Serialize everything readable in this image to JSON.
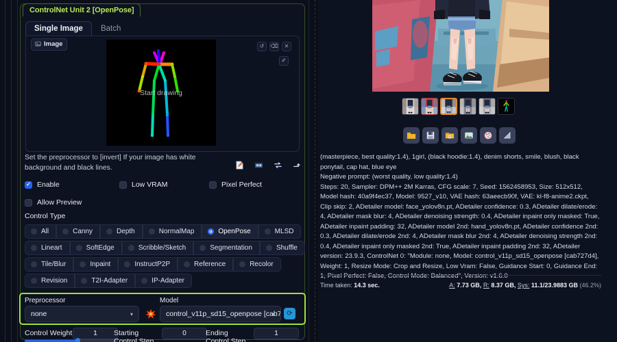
{
  "panel": {
    "accordion_title": "ControlNet Unit 2 [OpenPose]",
    "tabs": [
      {
        "label": "Single Image",
        "active": true
      },
      {
        "label": "Batch",
        "active": false
      }
    ],
    "image_chip_label": "Image",
    "canvas_hint": "Start drawing",
    "canvas_tools": [
      {
        "name": "undo-icon",
        "glyph": "↺"
      },
      {
        "name": "erase-icon",
        "glyph": "⌫"
      },
      {
        "name": "close-icon",
        "glyph": "✕"
      },
      {
        "name": "draw-icon",
        "glyph": "✎"
      }
    ],
    "hint_text": "Set the preprocessor to [invert] If your image has white background and black lines.",
    "mini_icons": [
      "open-new-canvas-icon",
      "send-to-img2img-icon",
      "swap-icon",
      "send-dimensions-icon"
    ],
    "checkboxes": [
      {
        "label": "Enable",
        "checked": true
      },
      {
        "label": "Low VRAM",
        "checked": false
      },
      {
        "label": "Pixel Perfect",
        "checked": false
      },
      {
        "label": "Allow Preview",
        "checked": false
      }
    ],
    "control_type_label": "Control Type",
    "control_types": [
      [
        "All",
        "Canny",
        "Depth",
        "NormalMap",
        "OpenPose",
        "MLSD"
      ],
      [
        "Lineart",
        "SoftEdge",
        "Scribble/Sketch",
        "Segmentation",
        "Shuffle"
      ],
      [
        "Tile/Blur",
        "Inpaint",
        "InstructP2P",
        "Reference",
        "Recolor"
      ],
      [
        "Revision",
        "T2I-Adapter",
        "IP-Adapter"
      ]
    ],
    "control_type_selected": "OpenPose",
    "preprocessor_label": "Preprocessor",
    "preprocessor_value": "none",
    "model_label": "Model",
    "model_value": "control_v11p_sd15_openpose [cab7",
    "refresh_icon": "refresh-icon",
    "star_icon": "explosion-icon",
    "sliders": [
      {
        "label": "Control Weight",
        "value": "1"
      },
      {
        "label": "Starting Control Step",
        "value": "0"
      },
      {
        "label": "Ending Control Step",
        "value": "1"
      }
    ],
    "highlight_color": "#9ee331",
    "accent_color": "#2563eb"
  },
  "output": {
    "thumbnails": [
      {
        "name": "thumb-1",
        "selected": false,
        "marked": false
      },
      {
        "name": "thumb-2",
        "selected": false,
        "marked": true
      },
      {
        "name": "thumb-3",
        "selected": true,
        "marked": false
      },
      {
        "name": "thumb-4",
        "selected": false,
        "marked": false
      },
      {
        "name": "thumb-5",
        "selected": false,
        "marked": false
      },
      {
        "name": "thumb-6-pose",
        "selected": false,
        "marked": false
      }
    ],
    "toolbar": [
      {
        "name": "folder-icon"
      },
      {
        "name": "save-icon"
      },
      {
        "name": "zip-icon"
      },
      {
        "name": "send-to-img2img-icon"
      },
      {
        "name": "send-to-inpaint-icon"
      },
      {
        "name": "send-to-extras-icon"
      }
    ],
    "metadata_lines": [
      "(masterpiece, best quality:1.4), 1girl, (black hoodie:1.4), denim shorts, smile, blush, black ponytail, cap hat, blue eye",
      "Negative prompt: (worst quality, low quality:1.4)",
      "Steps: 20, Sampler: DPM++ 2M Karras, CFG scale: 7, Seed: 1562458953, Size: 512x512, Model hash: 40a9f4ec37, Model: 9527_v10, VAE hash: 63aeecb90f, VAE: kl-f8-anime2.ckpt, Clip skip: 2, ADetailer model: face_yolov8n.pt, ADetailer confidence: 0.3, ADetailer dilate/erode: 4, ADetailer mask blur: 4, ADetailer denoising strength: 0.4, ADetailer inpaint only masked: True, ADetailer inpaint padding: 32, ADetailer model 2nd: hand_yolov8n.pt, ADetailer confidence 2nd: 0.3, ADetailer dilate/erode 2nd: 4, ADetailer mask blur 2nd: 4, ADetailer denoising strength 2nd: 0.4, ADetailer inpaint only masked 2nd: True, ADetailer inpaint padding 2nd: 32, ADetailer version: 23.9.3, ControlNet 0: \"Module: none, Model: control_v11p_sd15_openpose [cab727d4], Weight: 1, Resize Mode: Crop and Resize, Low Vram: False, Guidance Start: 0, Guidance End: 1, Pixel Perfect: False, Control Mode: Balanced\", Version: v1.6.0"
    ],
    "time_taken_label": "Time taken:",
    "time_taken_value": "14.3 sec.",
    "memory": {
      "a_label": "A:",
      "a_value": "7.73 GB,",
      "r_label": "R:",
      "r_value": "8.37 GB,",
      "sys_label": "Sys:",
      "sys_value": "11.1/23.9883 GB",
      "sys_pct": "(46.2%)"
    }
  }
}
